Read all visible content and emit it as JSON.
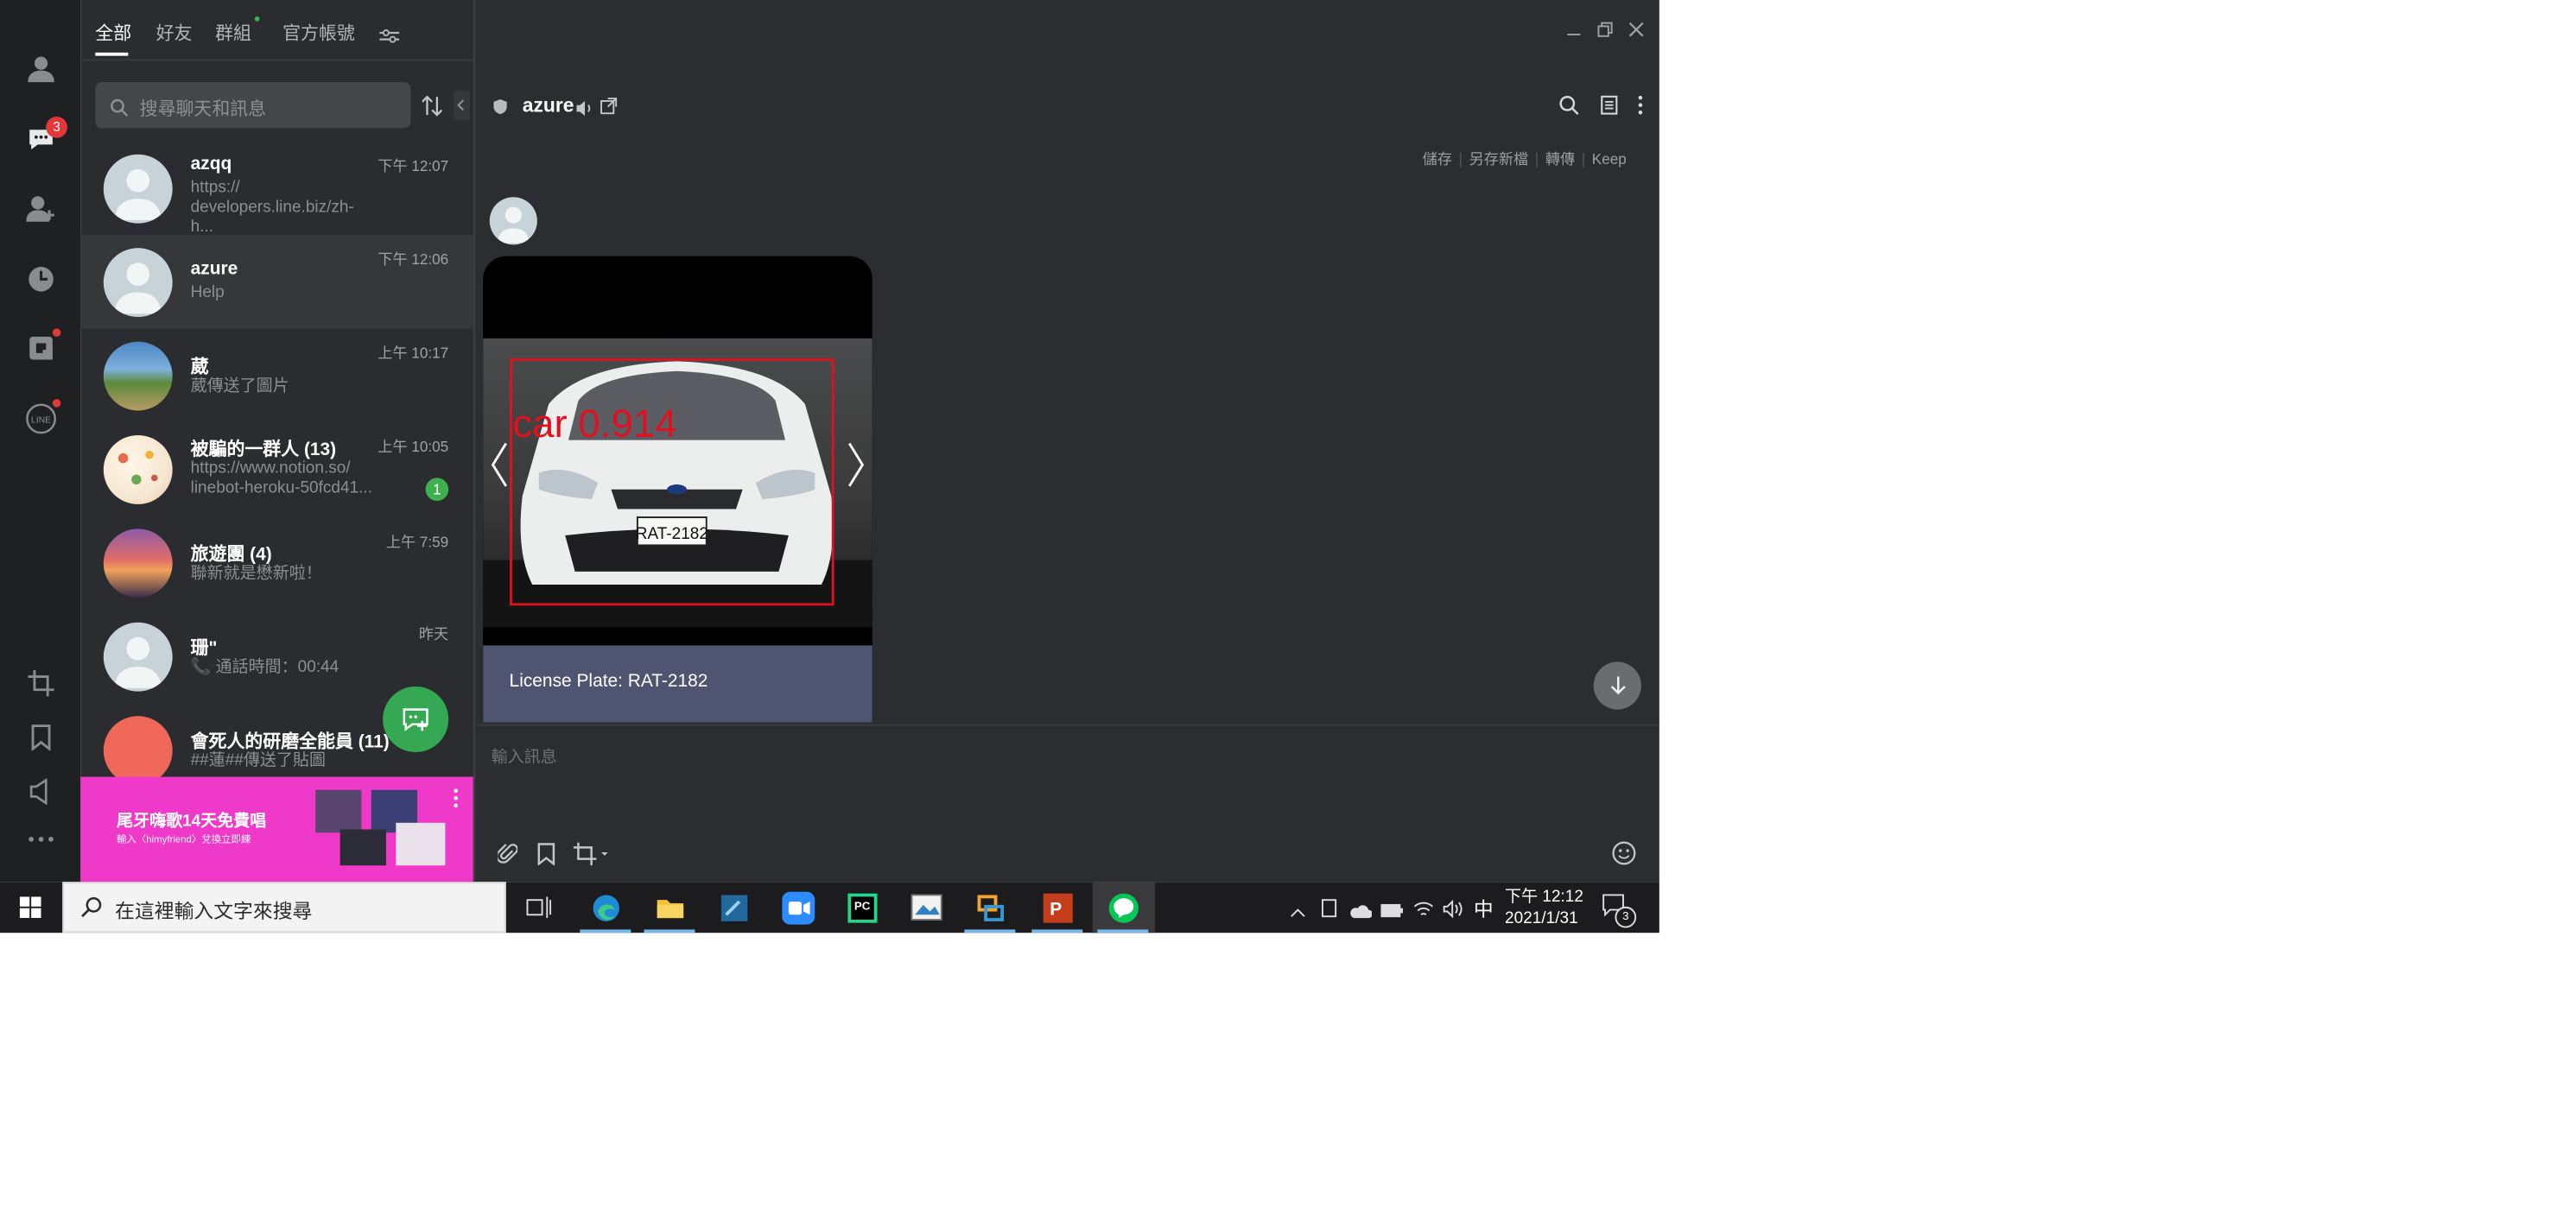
{
  "tabs": [
    "全部",
    "好友",
    "群組",
    "官方帳號"
  ],
  "rail": {
    "chat_badge": "3"
  },
  "search": {
    "placeholder": "搜尋聊天和訊息"
  },
  "chats": [
    {
      "name": "azqq",
      "preview": "https://\ndevelopers.line.biz/zh-h...",
      "time": "下午 12:07"
    },
    {
      "name": "azure",
      "preview": "Help",
      "time": "下午 12:06"
    },
    {
      "name": "葳",
      "preview": "葳傳送了圖片",
      "time": "上午 10:17"
    },
    {
      "name": "被騙的一群人 (13)",
      "preview": "https://www.notion.so/\nlinebot-heroku-50fcd41...",
      "time": "上午 10:05",
      "unread": "1"
    },
    {
      "name": "旅遊團 (4)",
      "preview": "聯新就是懋新啦！",
      "time": "上午 7:59"
    },
    {
      "name": "珊\"",
      "preview": "📞 通話時間：00:44",
      "time": "昨天"
    },
    {
      "name": "會死人的研磨全能員 (11)",
      "preview": "##蓮##傳送了貼圖",
      "time": ""
    }
  ],
  "ad": {
    "title": "尾牙嗨歌14天免費唱",
    "subtitle": "輸入〈himyfriend〉兌換立即練"
  },
  "chat": {
    "title": "azure",
    "actions": [
      "儲存",
      "另存新檔",
      "轉傳",
      "Keep"
    ],
    "image_label": "car 0.914",
    "plate": "RAT-2182",
    "caption": "License Plate: RAT-2182",
    "input_placeholder": "輸入訊息"
  },
  "taskbar": {
    "search_placeholder": "在這裡輸入文字來搜尋",
    "ime": "中",
    "time": "下午 12:12",
    "date": "2021/1/31",
    "notification_count": "3"
  },
  "colors": {
    "line_green": "#06c755",
    "fab_green": "#34a853",
    "ad_pink": "#ee39c9",
    "caption_bg": "#4f5571",
    "bbox_red": "#e01020"
  }
}
